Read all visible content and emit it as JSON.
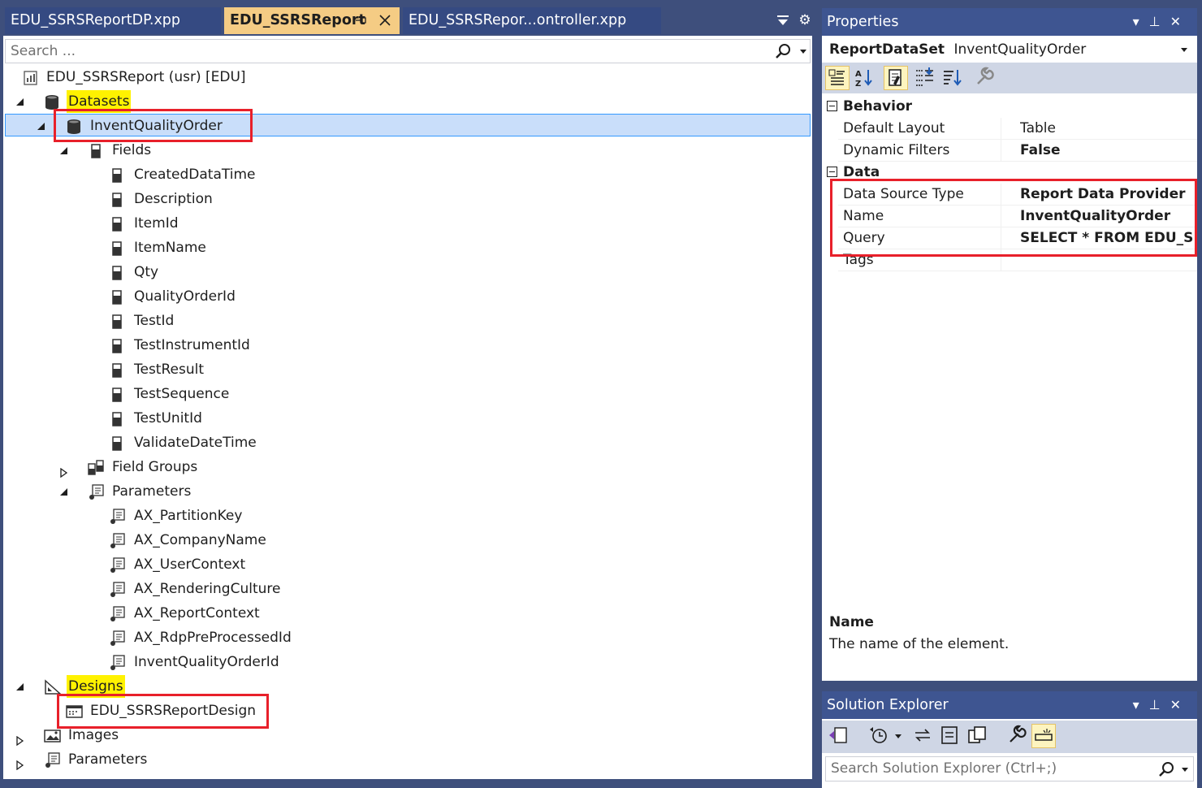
{
  "tabs": [
    {
      "label": "EDU_SSRSReportDP.xpp",
      "active": false
    },
    {
      "label": "EDU_SSRSReport",
      "active": true
    },
    {
      "label": "EDU_SSRSRepor...ontroller.xpp",
      "active": false
    }
  ],
  "tree": {
    "search_placeholder": "Search ...",
    "root": "EDU_SSRSReport (usr) [EDU]",
    "datasets": "Datasets",
    "dataset": "InventQualityOrder",
    "fields": "Fields",
    "field_items": [
      "CreatedDataTime",
      "Description",
      "ItemId",
      "ItemName",
      "Qty",
      "QualityOrderId",
      "TestId",
      "TestInstrumentId",
      "TestResult",
      "TestSequence",
      "TestUnitId",
      "ValidateDateTime"
    ],
    "field_groups": "Field Groups",
    "parameters": "Parameters",
    "parameter_items": [
      "AX_PartitionKey",
      "AX_CompanyName",
      "AX_UserContext",
      "AX_RenderingCulture",
      "AX_ReportContext",
      "AX_RdpPreProcessedId",
      "InventQualityOrderId"
    ],
    "designs": "Designs",
    "design": "EDU_SSRSReportDesign",
    "images": "Images",
    "parameters_root": "Parameters"
  },
  "properties": {
    "title": "Properties",
    "object_type": "ReportDataSet",
    "object_name": "InventQualityOrder",
    "categories": [
      {
        "name": "Behavior",
        "rows": [
          {
            "name": "Default Layout",
            "value": "Table",
            "bold": false
          },
          {
            "name": "Dynamic Filters",
            "value": "False",
            "bold": true
          }
        ]
      },
      {
        "name": "Data",
        "rows": [
          {
            "name": "Data Source Type",
            "value": "Report Data Provider",
            "bold": true
          },
          {
            "name": "Name",
            "value": "InventQualityOrder",
            "bold": true
          },
          {
            "name": "Query",
            "value": "SELECT * FROM EDU_SSRSReportTmp",
            "bold": true
          },
          {
            "name": "Tags",
            "value": "",
            "bold": false
          }
        ]
      }
    ],
    "description_title": "Name",
    "description_text": "The name of the element."
  },
  "solution_explorer": {
    "title": "Solution Explorer",
    "search_placeholder": "Search Solution Explorer (Ctrl+;)"
  },
  "colors": {
    "chrome": "#3e4f7c",
    "title_bar": "#3e5591",
    "active_tab": "#f5cc84",
    "selection": "#c9defa",
    "highlight": "#fff200",
    "callout": "#e8202a"
  }
}
